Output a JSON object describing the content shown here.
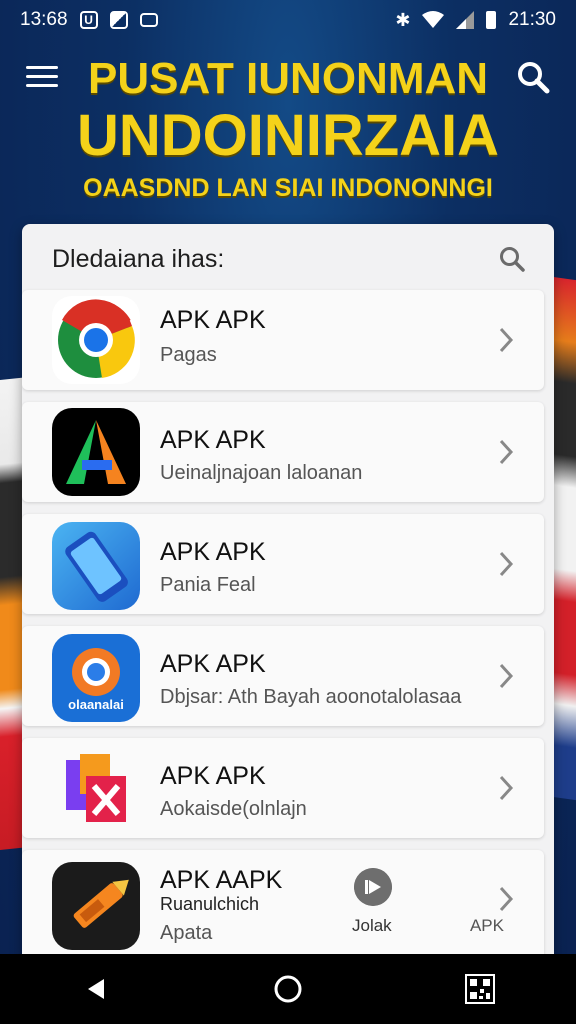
{
  "status_bar": {
    "time_left": "13:68",
    "time_right": "21:30"
  },
  "header": {
    "title_line1": "PUSAT IUNONMAN",
    "title_line2": "UNDOINIRZAIA",
    "subtitle": "OAASDND LAN SIAI INDONONNGI"
  },
  "card": {
    "title": "Dledaiana ihas:"
  },
  "apps": [
    {
      "name": "APK APK",
      "sub": "Pagas",
      "icon": "chrome-icon"
    },
    {
      "name": "APK APK",
      "sub": "Ueinaljnajoan laloanan",
      "icon": "triangle-a-icon"
    },
    {
      "name": "APK APK",
      "sub": "Pania Feal",
      "icon": "phone-icon"
    },
    {
      "name": "APK APK",
      "sub": "Dbjsar: Ath Bayah aoonotalolasaa",
      "icon": "browser-icon"
    },
    {
      "name": "APK APK",
      "sub": "Aokaisde(olnlajn",
      "icon": "dx-icon"
    },
    {
      "name": "APK AAPK",
      "sub2": "Ruanulchich",
      "sub": "Apata",
      "icon": "pen-tool-icon",
      "action_label": "Jolak",
      "right_label": "APK"
    }
  ],
  "icon_texts": {
    "browser_icon_label": "olaanalai"
  },
  "colors": {
    "title_yellow": "#f4d21a",
    "background_navy": "#0c2f63",
    "card_bg": "#f2f2f3"
  }
}
